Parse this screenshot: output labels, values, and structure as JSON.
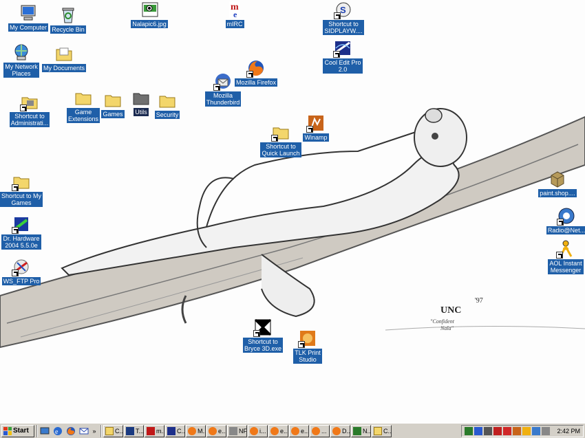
{
  "desktop": {
    "icons": [
      {
        "label": "My Computer",
        "icon": "computer-icon"
      },
      {
        "label": "Recycle Bin",
        "icon": "recycle-bin-icon"
      },
      {
        "label": "Nalapic6.jpg",
        "icon": "image-file-icon"
      },
      {
        "label": "mIRC",
        "icon": "mirc-icon"
      },
      {
        "label": "Shortcut to\nSIDPLAYW....",
        "icon": "sidplay-icon"
      },
      {
        "label": "My Network\nPlaces",
        "icon": "network-icon"
      },
      {
        "label": "My Documents",
        "icon": "folder-icon"
      },
      {
        "label": "Cool Edit Pro\n2.0",
        "icon": "cool-edit-icon"
      },
      {
        "label": "Mozilla Firefox",
        "icon": "firefox-icon"
      },
      {
        "label": "Mozilla\nThunderbird",
        "icon": "thunderbird-icon"
      },
      {
        "label": "Shortcut to\nAdministrati...",
        "icon": "admin-tools-icon"
      },
      {
        "label": "Game\nExtensions",
        "icon": "folder-icon"
      },
      {
        "label": "Games",
        "icon": "folder-icon"
      },
      {
        "label": "Utils",
        "icon": "folder-dark-icon"
      },
      {
        "label": "Security",
        "icon": "folder-icon"
      },
      {
        "label": "Winamp",
        "icon": "winamp-icon"
      },
      {
        "label": "Shortcut to\nQuick Launch",
        "icon": "folder-icon"
      },
      {
        "label": "paint.shop....",
        "icon": "paint-shop-icon"
      },
      {
        "label": "Shortcut to My\nGames",
        "icon": "folder-icon"
      },
      {
        "label": "Radio@Net...",
        "icon": "radio-icon"
      },
      {
        "label": "Dr. Hardware\n2004 5.5.0e",
        "icon": "dr-hardware-icon"
      },
      {
        "label": "AOL Instant\nMessenger",
        "icon": "aim-icon"
      },
      {
        "label": "WS_FTP Pro",
        "icon": "ftp-icon"
      },
      {
        "label": "Shortcut to\nBryce 3D.exe",
        "icon": "bryce-icon"
      },
      {
        "label": "TLK Print\nStudio",
        "icon": "tlk-icon"
      }
    ]
  },
  "taskbar": {
    "start_label": "Start",
    "quick_launch": [
      "desktop-icon",
      "ie-icon",
      "firefox-icon",
      "outlook-icon"
    ],
    "tasks": [
      {
        "label": "C...",
        "icon": "folder-icon"
      },
      {
        "label": "T...",
        "icon": "app-icon"
      },
      {
        "label": "m...",
        "icon": "mirc-icon"
      },
      {
        "label": "C...",
        "icon": "cool-edit-icon"
      },
      {
        "label": "M...",
        "icon": "firefox-icon"
      },
      {
        "label": "e...",
        "icon": "firefox-icon"
      },
      {
        "label": "NF...",
        "icon": "app-icon"
      },
      {
        "label": "i...",
        "icon": "firefox-icon"
      },
      {
        "label": "e...",
        "icon": "firefox-icon"
      },
      {
        "label": "e...",
        "icon": "firefox-icon"
      },
      {
        "label": "...",
        "icon": "firefox-icon"
      },
      {
        "label": "D...",
        "icon": "firefox-icon"
      },
      {
        "label": "N...",
        "icon": "app-icon"
      },
      {
        "label": "C...",
        "icon": "folder-icon"
      }
    ],
    "clock": "2:42 PM"
  }
}
